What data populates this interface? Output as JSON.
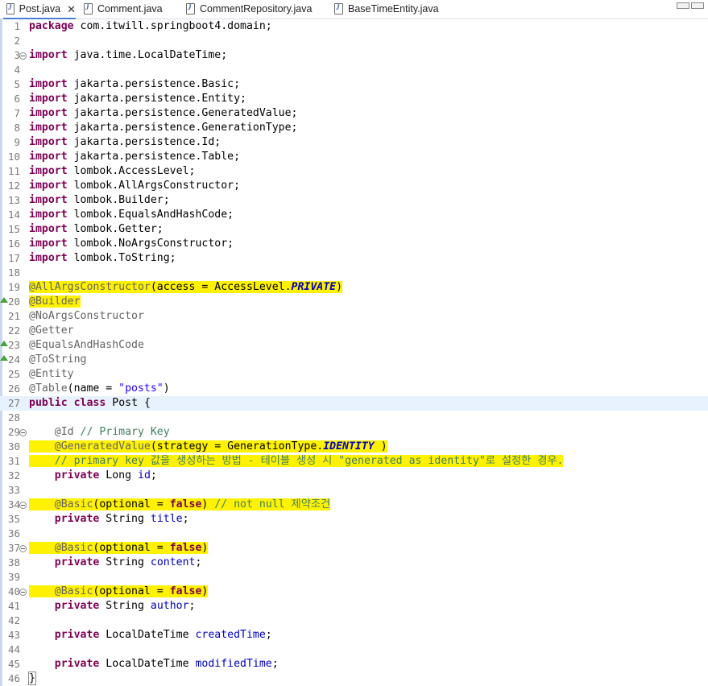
{
  "tabs": [
    {
      "label": "Post.java",
      "active": true
    },
    {
      "label": "Comment.java",
      "active": false
    },
    {
      "label": "CommentRepository.java",
      "active": false
    },
    {
      "label": "BaseTimeEntity.java",
      "active": false
    }
  ],
  "colors": {
    "keyword": "#7f0055",
    "annotation": "#646464",
    "comment": "#3f7f5f",
    "string": "#2a00ff",
    "field": "#0000c0",
    "highlight": "#fff200"
  },
  "code": [
    {
      "n": "1",
      "t": [
        [
          "kw",
          "package"
        ],
        [
          "",
          "com.itwill.springboot4.domain;"
        ]
      ]
    },
    {
      "n": "2",
      "t": []
    },
    {
      "n": "3",
      "fold": true,
      "t": [
        [
          "kw",
          "import"
        ],
        [
          "",
          "java.time.LocalDateTime;"
        ]
      ]
    },
    {
      "n": "4",
      "t": []
    },
    {
      "n": "5",
      "t": [
        [
          "kw",
          "import"
        ],
        [
          "",
          "jakarta.persistence.Basic;"
        ]
      ]
    },
    {
      "n": "6",
      "t": [
        [
          "kw",
          "import"
        ],
        [
          "",
          "jakarta.persistence.Entity;"
        ]
      ]
    },
    {
      "n": "7",
      "t": [
        [
          "kw",
          "import"
        ],
        [
          "",
          "jakarta.persistence.GeneratedValue;"
        ]
      ]
    },
    {
      "n": "8",
      "t": [
        [
          "kw",
          "import"
        ],
        [
          "",
          "jakarta.persistence.GenerationType;"
        ]
      ]
    },
    {
      "n": "9",
      "t": [
        [
          "kw",
          "import"
        ],
        [
          "",
          "jakarta.persistence.Id;"
        ]
      ]
    },
    {
      "n": "10",
      "t": [
        [
          "kw",
          "import"
        ],
        [
          "",
          "jakarta.persistence.Table;"
        ]
      ]
    },
    {
      "n": "11",
      "t": [
        [
          "kw",
          "import"
        ],
        [
          "",
          "lombok.AccessLevel;"
        ]
      ]
    },
    {
      "n": "12",
      "t": [
        [
          "kw",
          "import"
        ],
        [
          "",
          "lombok.AllArgsConstructor;"
        ]
      ]
    },
    {
      "n": "13",
      "t": [
        [
          "kw",
          "import"
        ],
        [
          "",
          "lombok.Builder;"
        ]
      ]
    },
    {
      "n": "14",
      "t": [
        [
          "kw",
          "import"
        ],
        [
          "",
          "lombok.EqualsAndHashCode;"
        ]
      ]
    },
    {
      "n": "15",
      "t": [
        [
          "kw",
          "import"
        ],
        [
          "",
          "lombok.Getter;"
        ]
      ]
    },
    {
      "n": "16",
      "t": [
        [
          "kw",
          "import"
        ],
        [
          "",
          "lombok.NoArgsConstructor;"
        ]
      ]
    },
    {
      "n": "17",
      "t": [
        [
          "kw",
          "import"
        ],
        [
          "",
          "lombok.ToString;"
        ]
      ]
    },
    {
      "n": "18",
      "t": []
    },
    {
      "n": "19",
      "hl": true,
      "t": [
        [
          "an",
          "@AllArgsConstructor"
        ],
        [
          "",
          "(access = AccessLevel."
        ],
        [
          "it",
          "PRIVATE"
        ],
        [
          "",
          ")"
        ]
      ]
    },
    {
      "n": "20",
      "ov": true,
      "hl": true,
      "t": [
        [
          "an",
          "@Builder"
        ]
      ]
    },
    {
      "n": "21",
      "t": [
        [
          "an",
          "@NoArgsConstructor"
        ]
      ]
    },
    {
      "n": "22",
      "t": [
        [
          "an",
          "@Getter"
        ]
      ]
    },
    {
      "n": "23",
      "ov": true,
      "t": [
        [
          "an",
          "@EqualsAndHashCode"
        ]
      ]
    },
    {
      "n": "24",
      "ov": true,
      "t": [
        [
          "an",
          "@ToString"
        ]
      ]
    },
    {
      "n": "25",
      "t": [
        [
          "an",
          "@Entity"
        ]
      ]
    },
    {
      "n": "26",
      "t": [
        [
          "an",
          "@Table"
        ],
        [
          "",
          "(name = "
        ],
        [
          "st",
          "\"posts\""
        ],
        [
          "",
          ")"
        ]
      ]
    },
    {
      "n": "27",
      "cur": true,
      "t": [
        [
          "kw",
          "public"
        ],
        [
          "kw",
          "class"
        ],
        [
          "",
          "Post {"
        ]
      ]
    },
    {
      "n": "28",
      "t": []
    },
    {
      "n": "29",
      "fold": true,
      "t": [
        [
          "",
          "    "
        ],
        [
          "an",
          "@Id"
        ],
        [
          "cm",
          " // Primary Key"
        ]
      ]
    },
    {
      "n": "30",
      "hl": true,
      "t": [
        [
          "",
          "    "
        ],
        [
          "an",
          "@GeneratedValue"
        ],
        [
          "",
          "(strategy = GenerationType."
        ],
        [
          "it",
          "IDENTITY"
        ],
        [
          "",
          " )"
        ]
      ]
    },
    {
      "n": "31",
      "hl": true,
      "t": [
        [
          "",
          "    "
        ],
        [
          "cm",
          "// primary key 값을 생성하는 방법 - 테이블 생성 시 \"generated as identity\"로 설정한 경우."
        ]
      ]
    },
    {
      "n": "32",
      "t": [
        [
          "",
          "    "
        ],
        [
          "kw",
          "private"
        ],
        [
          "",
          "Long "
        ],
        [
          "fd",
          "id"
        ],
        [
          "",
          ";"
        ]
      ]
    },
    {
      "n": "33",
      "t": []
    },
    {
      "n": "34",
      "fold": true,
      "hl": true,
      "t": [
        [
          "",
          "    "
        ],
        [
          "an",
          "@Basic"
        ],
        [
          "",
          "(optional = "
        ],
        [
          "kw",
          "false"
        ],
        [
          "",
          ") "
        ],
        [
          "cm",
          "// not null 제약조건"
        ]
      ]
    },
    {
      "n": "35",
      "t": [
        [
          "",
          "    "
        ],
        [
          "kw",
          "private"
        ],
        [
          "",
          "String "
        ],
        [
          "fd",
          "title"
        ],
        [
          "",
          ";"
        ]
      ]
    },
    {
      "n": "36",
      "t": []
    },
    {
      "n": "37",
      "fold": true,
      "hl": true,
      "t": [
        [
          "",
          "    "
        ],
        [
          "an",
          "@Basic"
        ],
        [
          "",
          "(optional = "
        ],
        [
          "kw",
          "false"
        ],
        [
          "",
          ")"
        ]
      ]
    },
    {
      "n": "38",
      "t": [
        [
          "",
          "    "
        ],
        [
          "kw",
          "private"
        ],
        [
          "",
          "String "
        ],
        [
          "fd",
          "content"
        ],
        [
          "",
          ";"
        ]
      ]
    },
    {
      "n": "39",
      "t": []
    },
    {
      "n": "40",
      "fold": true,
      "hl": true,
      "t": [
        [
          "",
          "    "
        ],
        [
          "an",
          "@Basic"
        ],
        [
          "",
          "(optional = "
        ],
        [
          "kw",
          "false"
        ],
        [
          "",
          ")"
        ]
      ]
    },
    {
      "n": "41",
      "t": [
        [
          "",
          "    "
        ],
        [
          "kw",
          "private"
        ],
        [
          "",
          "String "
        ],
        [
          "fd",
          "author"
        ],
        [
          "",
          ";"
        ]
      ]
    },
    {
      "n": "42",
      "t": []
    },
    {
      "n": "43",
      "t": [
        [
          "",
          "    "
        ],
        [
          "kw",
          "private"
        ],
        [
          "",
          "LocalDateTime "
        ],
        [
          "fd",
          "createdTime"
        ],
        [
          "",
          ";"
        ]
      ]
    },
    {
      "n": "44",
      "t": []
    },
    {
      "n": "45",
      "t": [
        [
          "",
          "    "
        ],
        [
          "kw",
          "private"
        ],
        [
          "",
          "LocalDateTime "
        ],
        [
          "fd",
          "modifiedTime"
        ],
        [
          "",
          ";"
        ]
      ]
    },
    {
      "n": "46",
      "t": [
        [
          "brace",
          "}"
        ]
      ]
    }
  ]
}
